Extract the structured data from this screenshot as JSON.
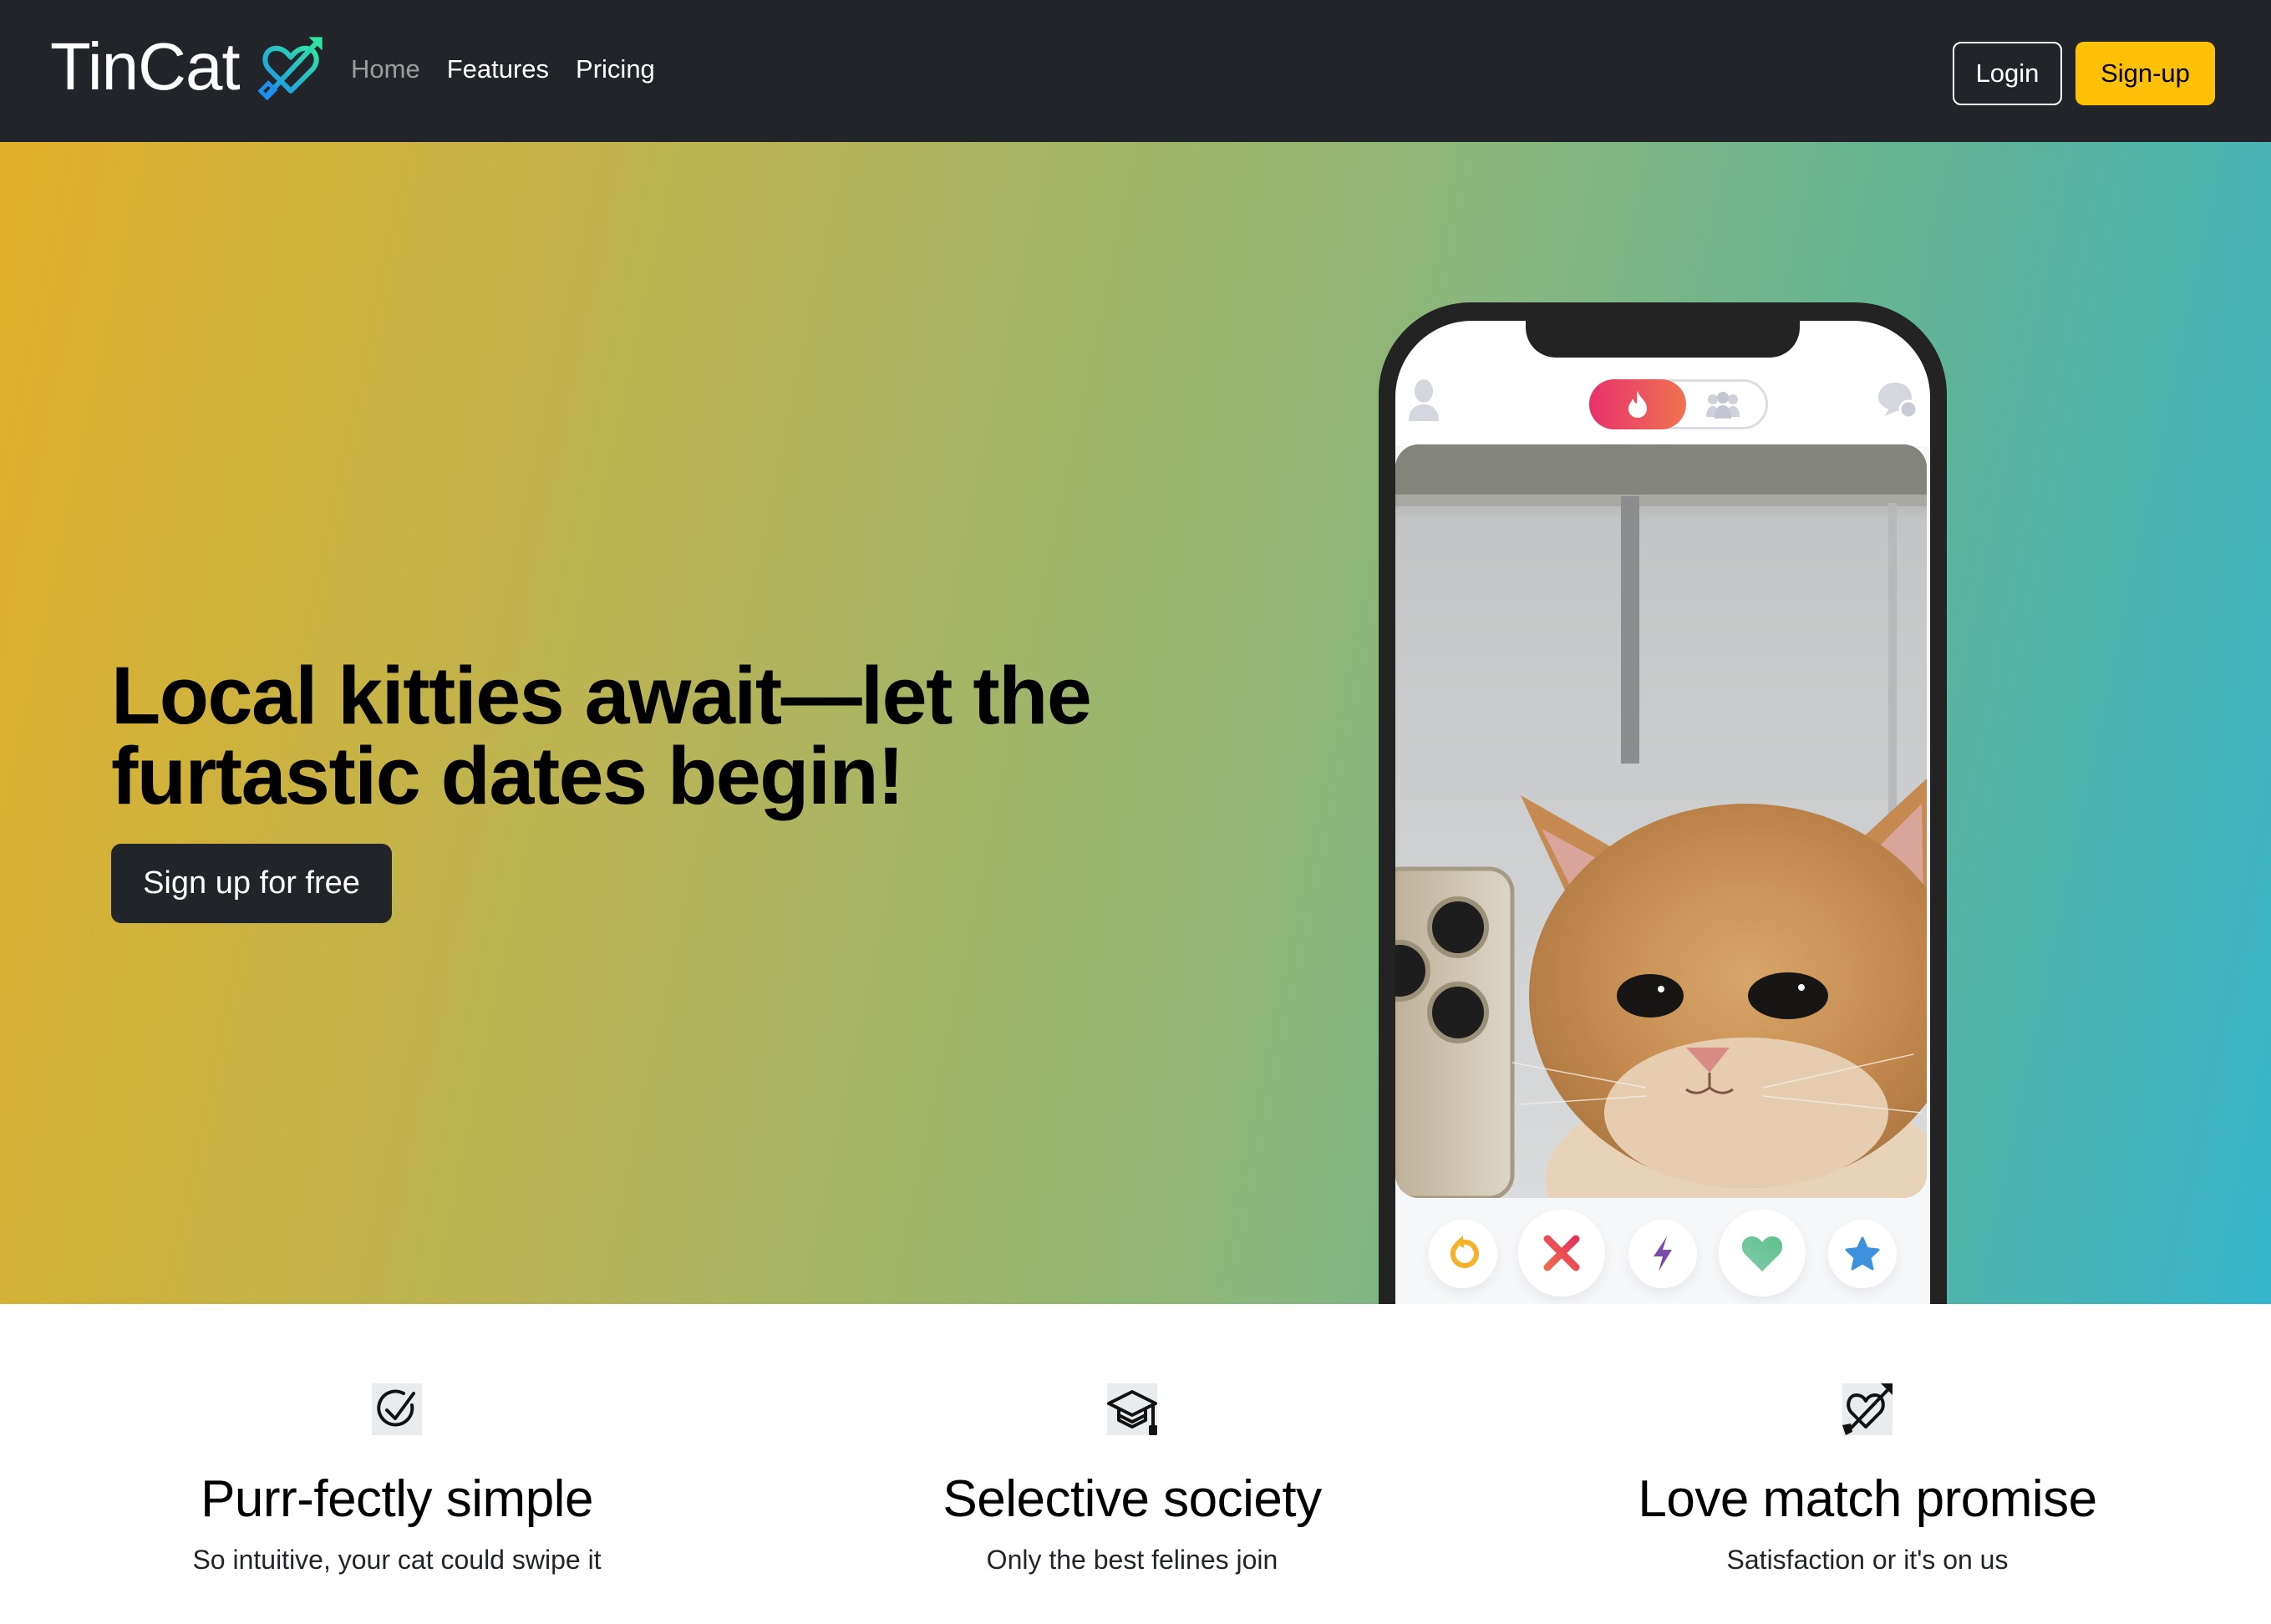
{
  "nav": {
    "brand": "TinCat",
    "brand_icon": "heart-arrow-icon",
    "links": [
      {
        "label": "Home",
        "active": true
      },
      {
        "label": "Features",
        "active": false
      },
      {
        "label": "Pricing",
        "active": false
      }
    ],
    "login_label": "Login",
    "signup_label": "Sign-up"
  },
  "hero": {
    "headline_line1": "Local kitties await—let the",
    "headline_line2": "furtastic dates begin!",
    "cta_label": "Sign up for free",
    "gradient": [
      "#e1b028",
      "#37b5cc"
    ]
  },
  "phone_mockup": {
    "top_bar": {
      "left_icon": "profile-icon",
      "toggle_active_icon": "flame-icon",
      "toggle_inactive_icon": "group-icon",
      "right_icon": "chat-bubbles-icon"
    },
    "photo_subject": "orange kitten taking a mirror selfie",
    "actions": [
      {
        "icon": "rewind-icon",
        "color": "#f4b12a"
      },
      {
        "icon": "nope-x-icon",
        "color": "#ea4a5c"
      },
      {
        "icon": "boost-bolt-icon",
        "color": "#7b4ba9"
      },
      {
        "icon": "like-heart-icon",
        "color": "#6cc59a"
      },
      {
        "icon": "super-like-star-icon",
        "color": "#3c92dd"
      }
    ]
  },
  "features": [
    {
      "icon": "check-circle-icon",
      "title": "Purr-fectly simple",
      "subtitle": "So intuitive, your cat could swipe it"
    },
    {
      "icon": "graduation-cap-icon",
      "title": "Selective society",
      "subtitle": "Only the best felines join"
    },
    {
      "icon": "heart-arrow-icon",
      "title": "Love match promise",
      "subtitle": "Satisfaction or it's on us"
    }
  ],
  "colors": {
    "nav_bg": "#212529",
    "signup_bg": "#ffc107",
    "cta_bg": "#212529"
  }
}
